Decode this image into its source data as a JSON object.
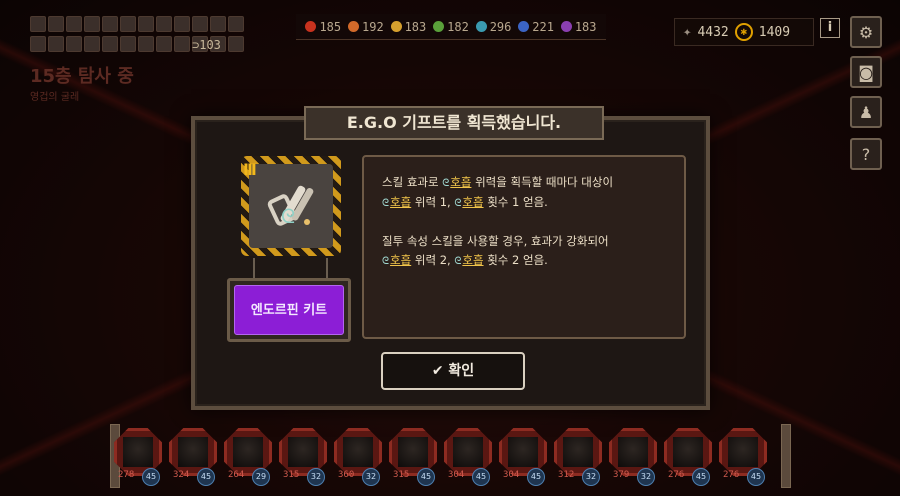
{
  "gifts": {
    "owned_count": "103",
    "slots": 24
  },
  "floor": {
    "title": "15층 탐사 중",
    "subtitle": "영겁의 굴레"
  },
  "resources": [
    {
      "value": "185",
      "color": "#c8321e"
    },
    {
      "value": "192",
      "color": "#d26a2a"
    },
    {
      "value": "183",
      "color": "#d6a02e"
    },
    {
      "value": "182",
      "color": "#5aa03a"
    },
    {
      "value": "296",
      "color": "#3a9ab0"
    },
    {
      "value": "221",
      "color": "#3b64c4"
    },
    {
      "value": "183",
      "color": "#8a3fb0"
    }
  ],
  "currency": {
    "shards": "4432",
    "lunacy": "1409"
  },
  "dialog": {
    "title": "E.G.O 기프트를 획득했습니다.",
    "tier": "III",
    "gift_name": "엔도르핀 키트",
    "desc_1a": "스킬 효과로 ",
    "desc_kw": "호흡",
    "desc_1b": " 위력을 획득할 때마다 대상이",
    "desc_1c": " 위력 1, ",
    "desc_1d": " 횟수 1 얻음.",
    "desc_2a": "질투 속성 스킬을 사용할 경우, 효과가 강화되어",
    "desc_2c": " 위력 2, ",
    "desc_2d": " 횟수 2 얻음.",
    "confirm_label": "확인"
  },
  "roster": [
    {
      "hp": "278",
      "sp": "45"
    },
    {
      "hp": "324",
      "sp": "45"
    },
    {
      "hp": "264",
      "sp": "29"
    },
    {
      "hp": "315",
      "sp": "32"
    },
    {
      "hp": "360",
      "sp": "32"
    },
    {
      "hp": "315",
      "sp": "45"
    },
    {
      "hp": "304",
      "sp": "45"
    },
    {
      "hp": "304",
      "sp": "45"
    },
    {
      "hp": "312",
      "sp": "32"
    },
    {
      "hp": "379",
      "sp": "32"
    },
    {
      "hp": "276",
      "sp": "45"
    },
    {
      "hp": "276",
      "sp": "45"
    }
  ],
  "icons": {
    "settings": "gear-icon",
    "theater": "theater-icon",
    "identity": "person-icon",
    "help": "help-icon"
  }
}
